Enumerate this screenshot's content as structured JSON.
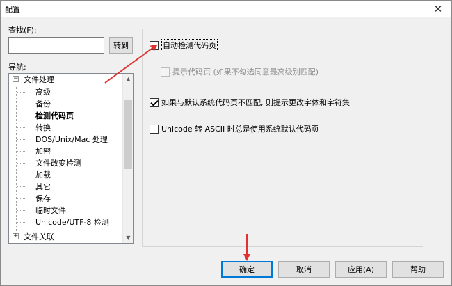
{
  "window": {
    "title": "配置",
    "close_glyph": "✕"
  },
  "search": {
    "label": "查找(F):",
    "value": "",
    "goto_label": "转到"
  },
  "nav": {
    "label": "导航:",
    "items": [
      {
        "label": "文件处理",
        "expanded": true
      },
      {
        "label": "高级"
      },
      {
        "label": "备份"
      },
      {
        "label": "检测代码页",
        "selected": true
      },
      {
        "label": "转换"
      },
      {
        "label": "DOS/Unix/Mac 处理"
      },
      {
        "label": "加密"
      },
      {
        "label": "文件改变检测"
      },
      {
        "label": "加载"
      },
      {
        "label": "其它"
      },
      {
        "label": "保存"
      },
      {
        "label": "临时文件"
      },
      {
        "label": "Unicode/UTF-8 检测"
      },
      {
        "label": "文件关联",
        "expanded": false
      }
    ]
  },
  "options": {
    "auto_detect": {
      "label": "自动检测代码页",
      "checked": false
    },
    "prompt_codepage": {
      "label": "提示代码页 (如果不勾选同意最高级别匹配)",
      "checked": false,
      "disabled": true
    },
    "mismatch_prompt": {
      "label": "如果与默认系统代码页不匹配, 则提示更改字体和字符集",
      "checked": true
    },
    "unicode_ascii": {
      "label": "Unicode 转 ASCII 时总是使用系统默认代码页",
      "checked": false
    }
  },
  "buttons": {
    "ok": "确定",
    "cancel": "取消",
    "apply": "应用(A)",
    "help": "帮助"
  },
  "icons": {
    "tree_expanded": "⊟",
    "tree_collapsed": "⊞",
    "scroll_up": "▲",
    "scroll_down": "▼"
  },
  "annotation_color": "#e03030"
}
